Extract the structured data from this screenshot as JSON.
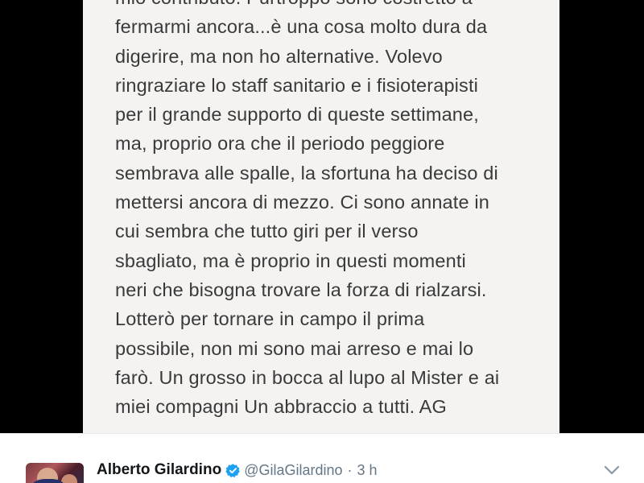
{
  "media": {
    "note_lines": [
      "mio contributo. Purtroppo sono costretto a",
      "fermarmi ancora...è una cosa molto dura da",
      "digerire, ma non ho alternative. Volevo",
      "ringraziare lo staff sanitario e i fisioterapisti",
      "per il grande supporto di queste settimane,",
      "ma, proprio ora che il periodo peggiore",
      "sembrava alle spalle, la sfortuna ha deciso di",
      "mettersi ancora di mezzo. Ci sono annate in",
      "cui sembra che tutto giri per il verso",
      "sbagliato, ma è proprio in questi momenti",
      "neri che bisogna trovare la forza di rialzarsi.",
      "Lotterò per tornare in campo il prima",
      "possibile, non mi sono mai arreso e mai lo",
      "farò. Un grosso in bocca al lupo al Mister e ai",
      "miei compagni Un abbraccio a tutti. AG"
    ]
  },
  "tweet": {
    "author_name": "Alberto Gilardino",
    "handle": "@GilaGilardino",
    "separator": "·",
    "time": "3 h"
  },
  "icons": {
    "verified": "verified-badge-icon",
    "more": "chevron-down-icon"
  },
  "colors": {
    "verified": "#1da1f2",
    "secondary_text": "#657786",
    "note_text": "#3a3a3a",
    "note_background": "#f4f3f1"
  }
}
